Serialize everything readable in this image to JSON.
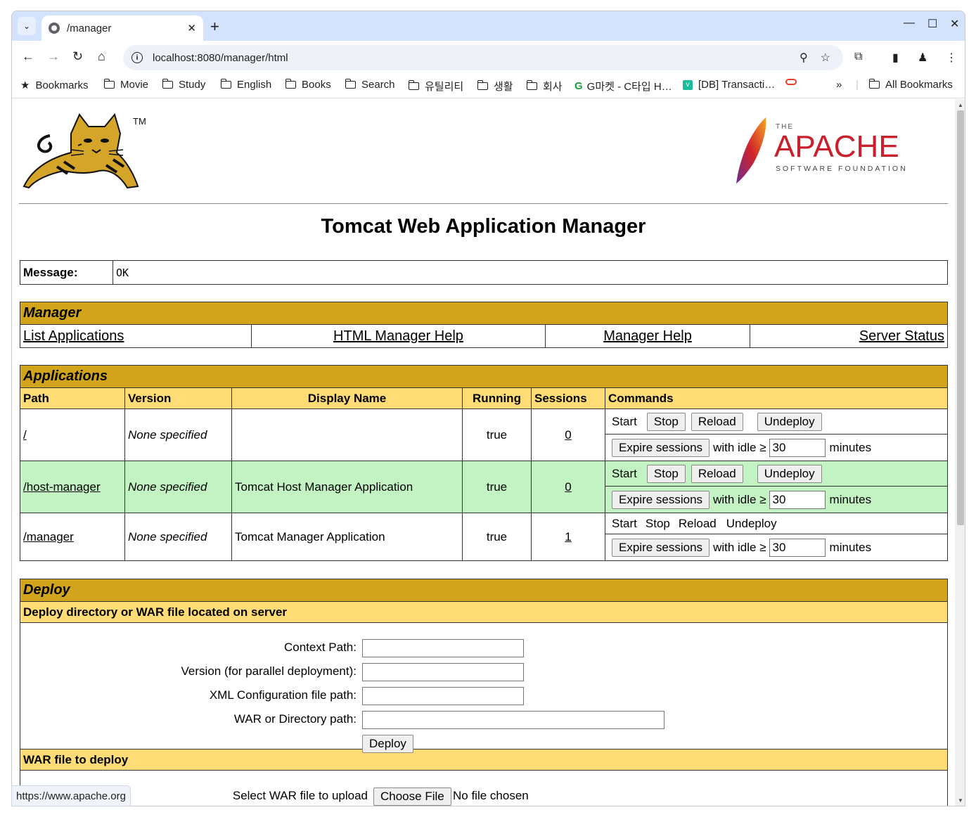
{
  "browser": {
    "tab_title": "/manager",
    "url": "localhost:8080/manager/html",
    "status_url": "https://www.apache.org",
    "bookmarks": [
      {
        "label": "Bookmarks",
        "icon": "star-icon"
      },
      {
        "label": "Movie",
        "icon": "folder-icon"
      },
      {
        "label": "Study",
        "icon": "folder-icon"
      },
      {
        "label": "English",
        "icon": "folder-icon"
      },
      {
        "label": "Books",
        "icon": "folder-icon"
      },
      {
        "label": "Search",
        "icon": "folder-icon"
      },
      {
        "label": "유틸리티",
        "icon": "folder-icon"
      },
      {
        "label": "생활",
        "icon": "folder-icon"
      },
      {
        "label": "회사",
        "icon": "folder-icon"
      },
      {
        "label": "G마켓 - C타입 H…",
        "icon": "gmarket-icon"
      },
      {
        "label": "[DB] Transacti…",
        "icon": "v-icon"
      }
    ],
    "all_bookmarks": "All Bookmarks",
    "overflow": "»"
  },
  "page": {
    "title": "Tomcat Web Application Manager",
    "tm": "TM",
    "apache_the": "THE",
    "apache_name": "APACHE",
    "apache_sub": "SOFTWARE FOUNDATION",
    "message_label": "Message:",
    "message_value": "OK",
    "manager": {
      "header": "Manager",
      "links": [
        "List Applications",
        "HTML Manager Help",
        "Manager Help",
        "Server Status"
      ]
    },
    "applications": {
      "header": "Applications",
      "columns": [
        "Path",
        "Version",
        "Display Name",
        "Running",
        "Sessions",
        "Commands"
      ],
      "rows": [
        {
          "path": "/",
          "version": "None specified",
          "display_name": "",
          "running": "true",
          "sessions": "0"
        },
        {
          "path": "/host-manager",
          "version": "None specified",
          "display_name": "Tomcat Host Manager Application",
          "running": "true",
          "sessions": "0"
        },
        {
          "path": "/manager",
          "version": "None specified",
          "display_name": "Tomcat Manager Application",
          "running": "true",
          "sessions": "1"
        }
      ],
      "cmd_start": "Start",
      "cmd_stop": "Stop",
      "cmd_reload": "Reload",
      "cmd_undeploy": "Undeploy",
      "expire_label": "Expire sessions",
      "with_idle": "with idle ≥",
      "idle_value": "30",
      "minutes": "minutes"
    },
    "deploy": {
      "header": "Deploy",
      "server_section": "Deploy directory or WAR file located on server",
      "context_path": "Context Path:",
      "version_label": "Version (for parallel deployment):",
      "xml_path": "XML Configuration file path:",
      "war_path": "WAR or Directory path:",
      "deploy_button": "Deploy",
      "war_section": "WAR file to deploy",
      "select_war": "Select WAR file to upload",
      "choose_file": "Choose File",
      "no_file": "No file chosen"
    }
  }
}
